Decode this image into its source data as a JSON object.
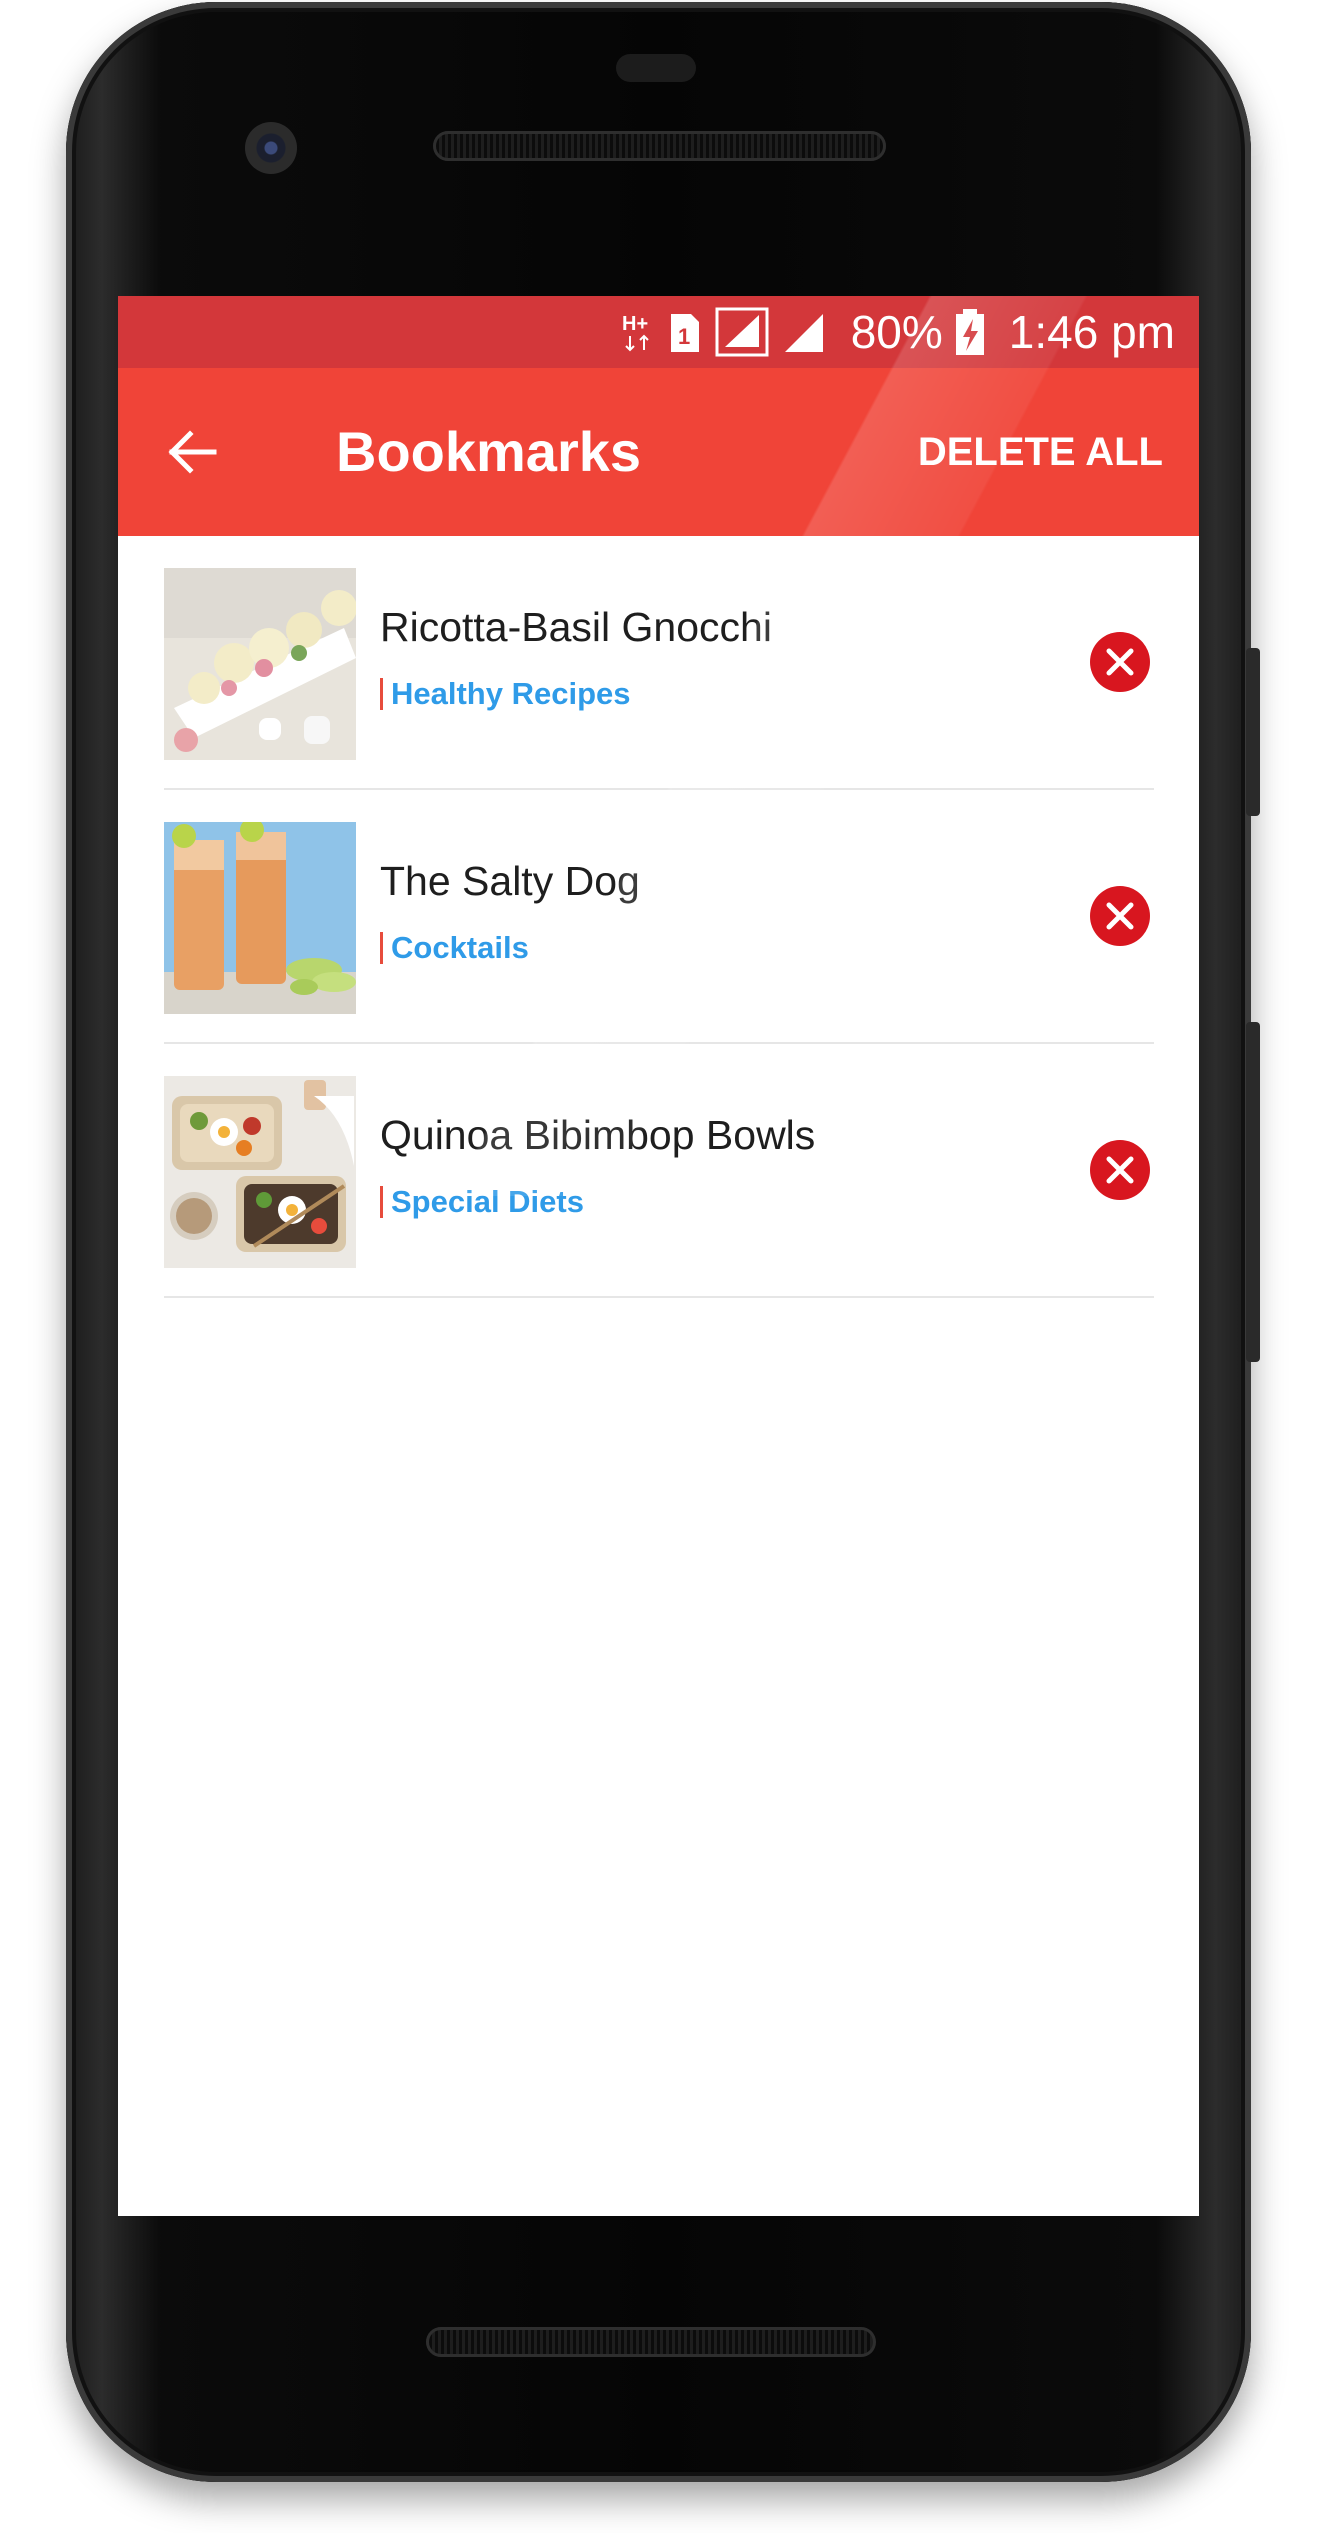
{
  "status_bar": {
    "network_type": "H+",
    "sim_slot": "1",
    "battery": "80%",
    "time": "1:46 pm"
  },
  "app_bar": {
    "title": "Bookmarks",
    "delete_all_label": "DELETE ALL",
    "back_icon": "arrow-left-icon"
  },
  "bookmarks": [
    {
      "title": "Ricotta-Basil Gnocchi",
      "category": "Healthy Recipes",
      "thumb": "gnocchi-photo"
    },
    {
      "title": "The Salty Dog",
      "category": "Cocktails",
      "thumb": "cocktail-photo"
    },
    {
      "title": "Quinoa Bibimbop Bowls",
      "category": "Special Diets",
      "thumb": "bibimbop-photo"
    }
  ],
  "colors": {
    "status_bar": "#d3373a",
    "app_bar": "#f04438",
    "category_text": "#2f9be8",
    "category_marker": "#e74c3c",
    "remove_button": "#d8161f"
  }
}
